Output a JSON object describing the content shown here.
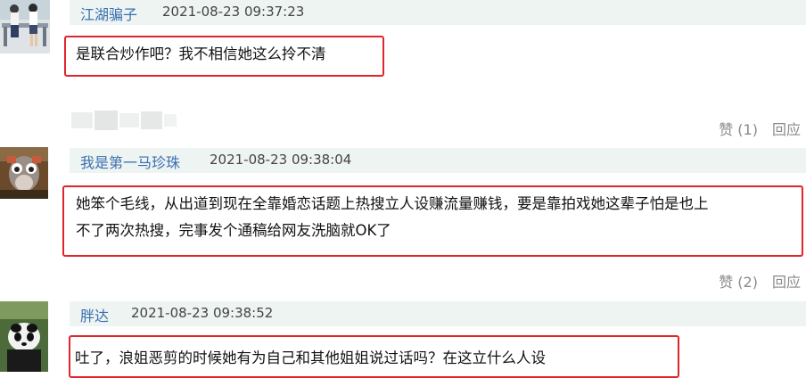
{
  "comments": [
    {
      "author": "江湖骗子",
      "timestamp": "2021-08-23 09:37:23",
      "content": [
        "是联合炒作吧？我不相信她这么拎不清"
      ]
    },
    {
      "author": "我是第一马珍珠",
      "timestamp": "2021-08-23 09:38:04",
      "content": [
        "她笨个毛线，从出道到现在全靠婚恋话题上热搜立人设赚流量赚钱，要是靠拍戏她这辈子怕是也上",
        "不了两次热搜，完事发个通稿给网友洗脑就OK了"
      ]
    },
    {
      "author": "胖达",
      "timestamp": "2021-08-23 09:38:52",
      "content": [
        "吐了，浪姐恶剪的时候她有为自己和其他姐姐说过话吗？在这立什么人设"
      ]
    }
  ],
  "actions": [
    {
      "like": "赞 (1)",
      "reply": "回应"
    },
    {
      "like": "赞 (2)",
      "reply": "回应"
    }
  ]
}
